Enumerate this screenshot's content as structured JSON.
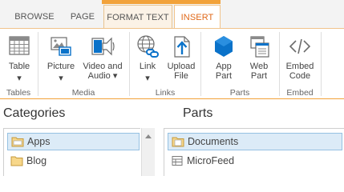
{
  "tabs": {
    "browse": "BROWSE",
    "page": "PAGE",
    "format_text": "FORMAT TEXT",
    "insert": "INSERT"
  },
  "ribbon": {
    "groups": {
      "tables": "Tables",
      "media": "Media",
      "links": "Links",
      "parts": "Parts",
      "embed": "Embed"
    },
    "buttons": {
      "table": [
        "Table",
        "▾"
      ],
      "picture": [
        "Picture",
        "▾"
      ],
      "video_audio": [
        "Video and",
        "Audio ▾"
      ],
      "link": [
        "Link",
        "▾"
      ],
      "upload_file": [
        "Upload",
        "File"
      ],
      "app_part": [
        "App",
        "Part"
      ],
      "web_part": [
        "Web",
        "Part"
      ],
      "embed_code": [
        "Embed",
        "Code"
      ]
    }
  },
  "categories": {
    "title": "Categories",
    "items": [
      "Apps",
      "Blog"
    ]
  },
  "parts": {
    "title": "Parts",
    "items": [
      "Documents",
      "MicroFeed"
    ]
  },
  "colors": {
    "accent_orange": "#e0691a",
    "contextual_tab": "#f2a23a",
    "selection": "#dcebf7",
    "icon_blue": "#0a72c9"
  }
}
